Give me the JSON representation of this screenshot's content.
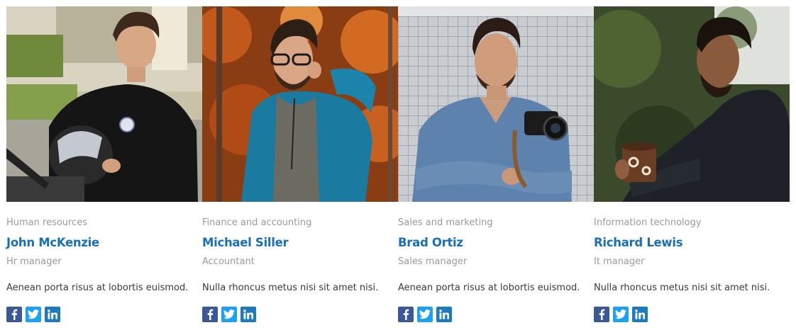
{
  "colors": {
    "name": "#1a6fb5",
    "muted": "#9a9a9a",
    "text": "#3a3a3a",
    "facebook": "#3b5998",
    "twitter": "#1da1f2",
    "linkedin": "#1d7abf"
  },
  "team": [
    {
      "department": "Human resources",
      "name": "John McKenzie",
      "role": "Hr manager",
      "bio": "Aenean porta risus at lobortis euismod.",
      "photo": "man-with-motorcycle-helmet-photo"
    },
    {
      "department": "Finance and accounting",
      "name": "Michael Siller",
      "role": "Accountant",
      "bio": "Nulla rhoncus metus nisi sit amet nisi.",
      "photo": "man-with-glasses-autumn-photo"
    },
    {
      "department": "Sales and marketing",
      "name": "Brad Ortiz",
      "role": "Sales manager",
      "bio": "Aenean porta risus at lobortis euismod.",
      "photo": "man-with-camera-photo"
    },
    {
      "department": "Information technology",
      "name": "Richard Lewis",
      "role": "It manager",
      "bio": "Nulla rhoncus metus nisi sit amet nisi.",
      "photo": "man-with-mug-photo"
    }
  ],
  "social_icons": [
    "facebook-icon",
    "twitter-icon",
    "linkedin-icon"
  ]
}
